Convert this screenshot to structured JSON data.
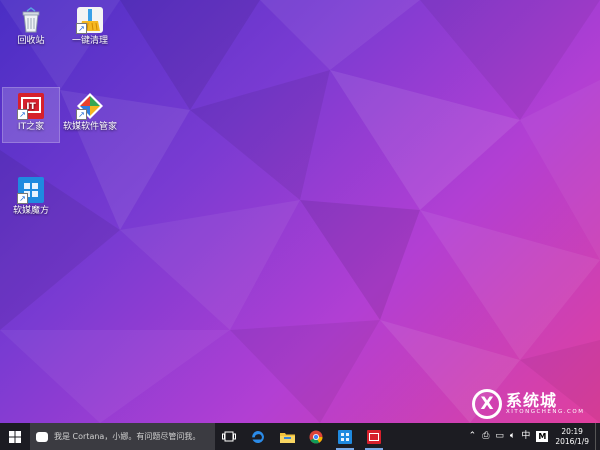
{
  "desktop": {
    "colors": {
      "top_left": "#4a2ec4",
      "middle": "#b23fd3",
      "bottom_right": "#e1409d"
    },
    "icons": [
      {
        "label": "回收站",
        "icon": "recycle-bin-icon",
        "selected": false
      },
      {
        "label": "一键清理",
        "icon": "broom-cleaner-icon",
        "selected": false
      },
      {
        "label": "IT之家",
        "icon": "ithome-icon",
        "glyph": "IT",
        "selected": true
      },
      {
        "label": "软媒软件管家",
        "icon": "software-manager-icon",
        "selected": false
      },
      {
        "label": "软媒魔方",
        "icon": "cube-tool-icon",
        "selected": false
      }
    ]
  },
  "taskbar": {
    "background": "#1c1c22",
    "search": {
      "placeholder": "我是 Cortana，小娜。有问题尽管问我。"
    },
    "pinned": [
      "task-view-icon",
      "edge-browser-icon",
      "file-explorer-icon",
      "chrome-icon",
      "cube-tool-icon",
      "ithome-icon"
    ],
    "tray": {
      "ime_label": "中",
      "ime_mode": "M",
      "time": "20:19",
      "date": "2016/1/9"
    }
  },
  "watermark": {
    "logo_letter": "X",
    "text": "系统城",
    "subtext": "XITONGCHENG.COM"
  }
}
